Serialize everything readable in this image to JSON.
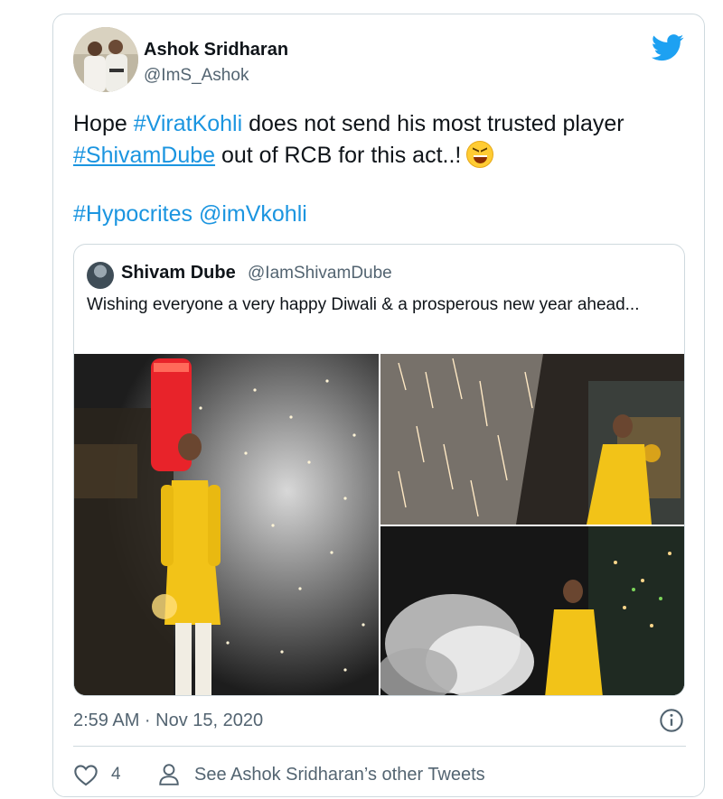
{
  "author": {
    "name": "Ashok Sridharan",
    "handle": "@ImS_Ashok"
  },
  "tweet": {
    "text_part1": "Hope ",
    "hashtag1": "#ViratKohli",
    "text_part2": " does not send his most trusted player ",
    "hashtag2": "#ShivamDube",
    "text_part3": " out of RCB for this act..!",
    "hashtag3": "#Hypocrites",
    "mention": "@imVkohli"
  },
  "quoted": {
    "name": "Shivam Dube",
    "handle": "@IamShivamDube",
    "text": "Wishing everyone a very happy Diwali & a prosperous new year ahead..."
  },
  "timestamp": "2:59 AM · Nov 15, 2020",
  "actions": {
    "likes": "4",
    "other_tweets": "See Ashok Sridharan’s other Tweets"
  },
  "colors": {
    "twitter_blue": "#1da1f2",
    "link": "#1b95e0",
    "muted": "#536471",
    "border": "#cfd9de"
  },
  "icons": [
    "twitter-bird-icon",
    "info-icon",
    "heart-icon",
    "person-icon",
    "grinning-squinting-emoji"
  ]
}
